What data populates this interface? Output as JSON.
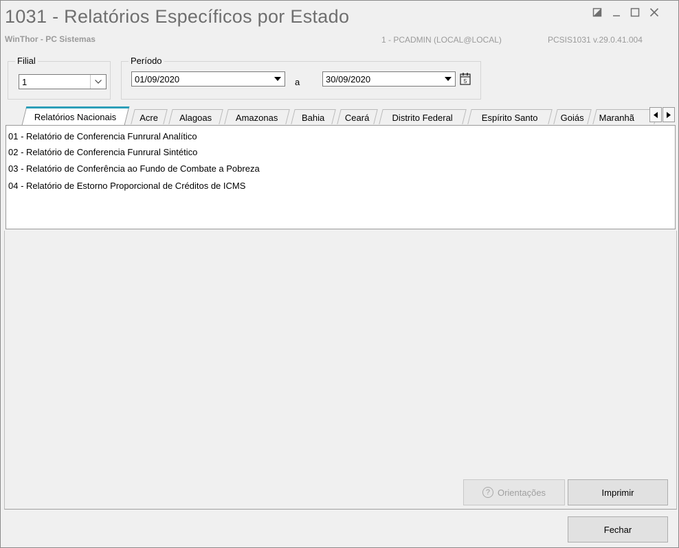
{
  "window": {
    "title": "1031 - Relatórios Específicos por Estado",
    "subtitle": "WinThor - PC Sistemas",
    "user": "1 - PCADMIN (LOCAL@LOCAL)",
    "build": "PCSIS1031  v.29.0.41.004",
    "controls": {
      "restore": "restore-icon",
      "minimize": "minimize-icon",
      "maximize": "maximize-icon",
      "close": "close-icon"
    }
  },
  "filial": {
    "label": "Filial",
    "value": "1"
  },
  "periodo": {
    "label": "Período",
    "start": "01/09/2020",
    "separator": "a",
    "end": "30/09/2020"
  },
  "tabs": [
    {
      "label": "Relatórios Nacionais",
      "active": true
    },
    {
      "label": "Acre"
    },
    {
      "label": "Alagoas"
    },
    {
      "label": "Amazonas"
    },
    {
      "label": "Bahia"
    },
    {
      "label": "Ceará"
    },
    {
      "label": "Distrito Federal"
    },
    {
      "label": "Espírito Santo"
    },
    {
      "label": "Goiás"
    },
    {
      "label": "Maranhã"
    }
  ],
  "reports": [
    "01 - Relatório de Conferencia Funrural Analítico",
    "02 - Relatório de Conferencia Funrural Sintético",
    "03 - Relatório de Conferência ao Fundo de Combate a Pobreza",
    "04 - Relatório de Estorno Proporcional de Créditos de ICMS"
  ],
  "buttons": {
    "help": "Orientações",
    "print": "Imprimir",
    "close": "Fechar"
  },
  "colors": {
    "active_tab_accent": "#2d9fb8",
    "window_bg": "#f0f0f0"
  }
}
